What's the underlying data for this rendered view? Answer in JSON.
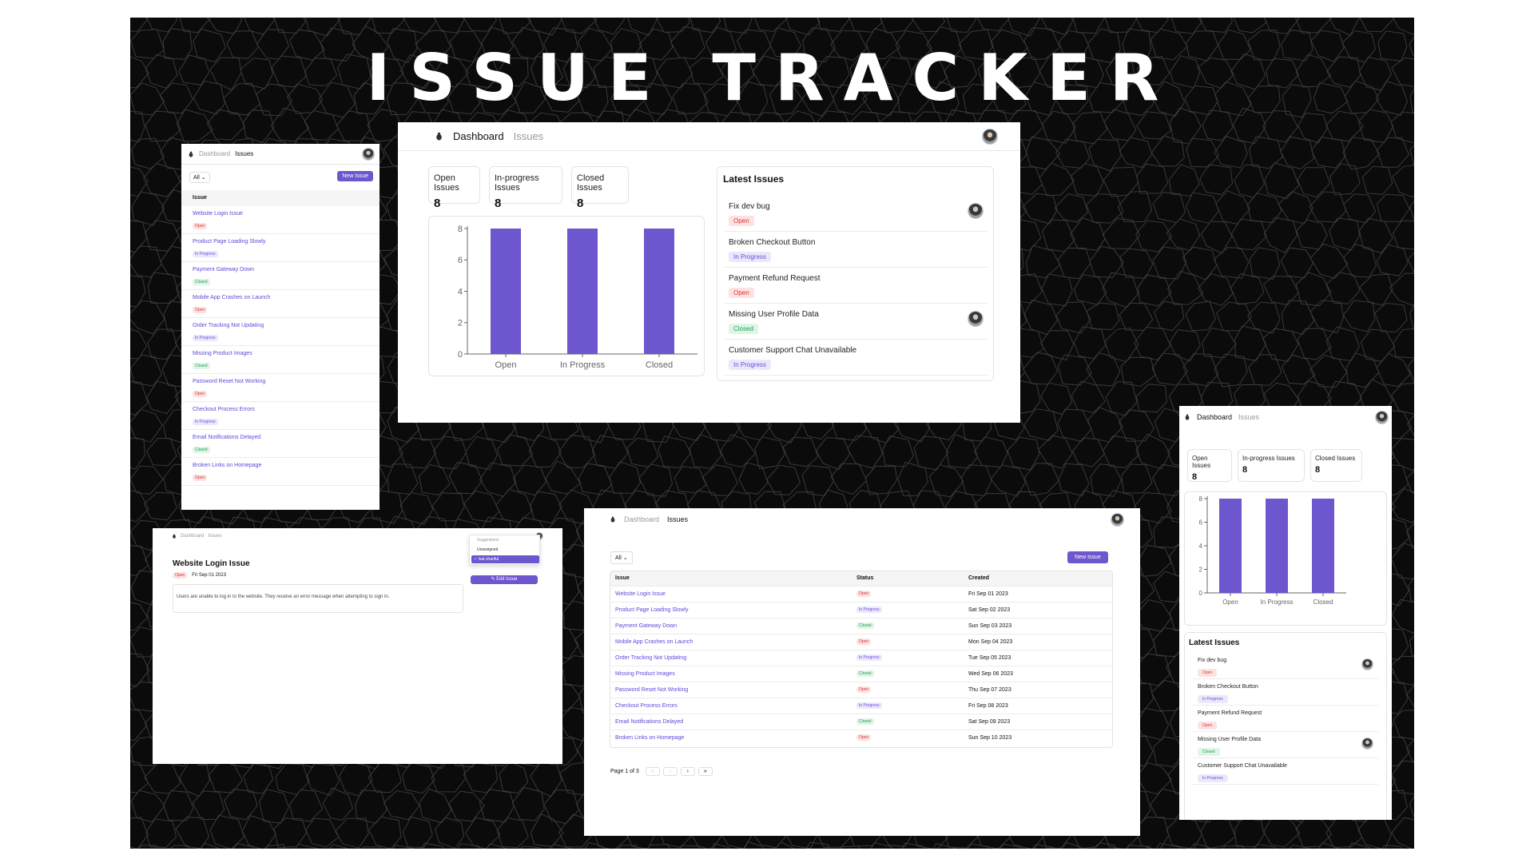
{
  "title": "ISSUE TRACKER",
  "colors": {
    "accent": "#6e56cf",
    "bar": "#6e56cf",
    "open": "#d33",
    "progress": "#6a4fd0",
    "closed": "#1f9d55"
  },
  "nav": {
    "dashboard": "Dashboard",
    "issues": "Issues"
  },
  "stats": [
    {
      "label": "Open Issues",
      "value": "8"
    },
    {
      "label": "In-progress Issues",
      "value": "8"
    },
    {
      "label": "Closed Issues",
      "value": "8"
    }
  ],
  "chart_data": {
    "type": "bar",
    "categories": [
      "Open",
      "In Progress",
      "Closed"
    ],
    "values": [
      8,
      8,
      8
    ],
    "ylim": [
      0,
      8
    ],
    "yticks": [
      "0",
      "2",
      "4",
      "6",
      "8"
    ],
    "grid": false
  },
  "latest": {
    "title": "Latest Issues",
    "items": [
      {
        "title": "Fix dev bug",
        "status": "Open",
        "status_class": "open",
        "avatar": true
      },
      {
        "title": "Broken Checkout Button",
        "status": "In Progress",
        "status_class": "progress",
        "avatar": false
      },
      {
        "title": "Payment Refund Request",
        "status": "Open",
        "status_class": "open",
        "avatar": false
      },
      {
        "title": "Missing User Profile Data",
        "status": "Closed",
        "status_class": "closed",
        "avatar": true
      },
      {
        "title": "Customer Support Chat Unavailable",
        "status": "In Progress",
        "status_class": "progress",
        "avatar": false
      }
    ]
  },
  "issues_list": {
    "filter": "All",
    "new_issue": "New Issue",
    "headers": {
      "issue": "Issue",
      "status": "Status",
      "created": "Created"
    },
    "rows": [
      {
        "title": "Website Login Issue",
        "status": "Open",
        "status_class": "open",
        "created": "Fri Sep 01 2023"
      },
      {
        "title": "Product Page Loading Slowly",
        "status": "In Progress",
        "status_class": "progress",
        "created": "Sat Sep 02 2023"
      },
      {
        "title": "Payment Gateway Down",
        "status": "Closed",
        "status_class": "closed",
        "created": "Sun Sep 03 2023"
      },
      {
        "title": "Mobile App Crashes on Launch",
        "status": "Open",
        "status_class": "open",
        "created": "Mon Sep 04 2023"
      },
      {
        "title": "Order Tracking Not Updating",
        "status": "In Progress",
        "status_class": "progress",
        "created": "Tue Sep 05 2023"
      },
      {
        "title": "Missing Product Images",
        "status": "Closed",
        "status_class": "closed",
        "created": "Wed Sep 06 2023"
      },
      {
        "title": "Password Reset Not Working",
        "status": "Open",
        "status_class": "open",
        "created": "Thu Sep 07 2023"
      },
      {
        "title": "Checkout Process Errors",
        "status": "In Progress",
        "status_class": "progress",
        "created": "Fri Sep 08 2023"
      },
      {
        "title": "Email Notifications Delayed",
        "status": "Closed",
        "status_class": "closed",
        "created": "Sat Sep 09 2023"
      },
      {
        "title": "Broken Links on Homepage",
        "status": "Open",
        "status_class": "open",
        "created": "Sun Sep 10 2023"
      }
    ],
    "pagination": {
      "label": "Page 1 of 3",
      "first": "«",
      "prev": "‹",
      "next": "›",
      "last": "»"
    }
  },
  "detail": {
    "title": "Website Login Issue",
    "status": "Open",
    "date": "Fri Sep 01 2023",
    "description": "Users are unable to log in to the website. They receive an error message when attempting to sign in.",
    "dropdown": {
      "header": "Suggestions",
      "options": [
        "Unassigned",
        "Isat shariful"
      ],
      "selected_index": 1
    },
    "edit_button": "Edit Issue"
  }
}
